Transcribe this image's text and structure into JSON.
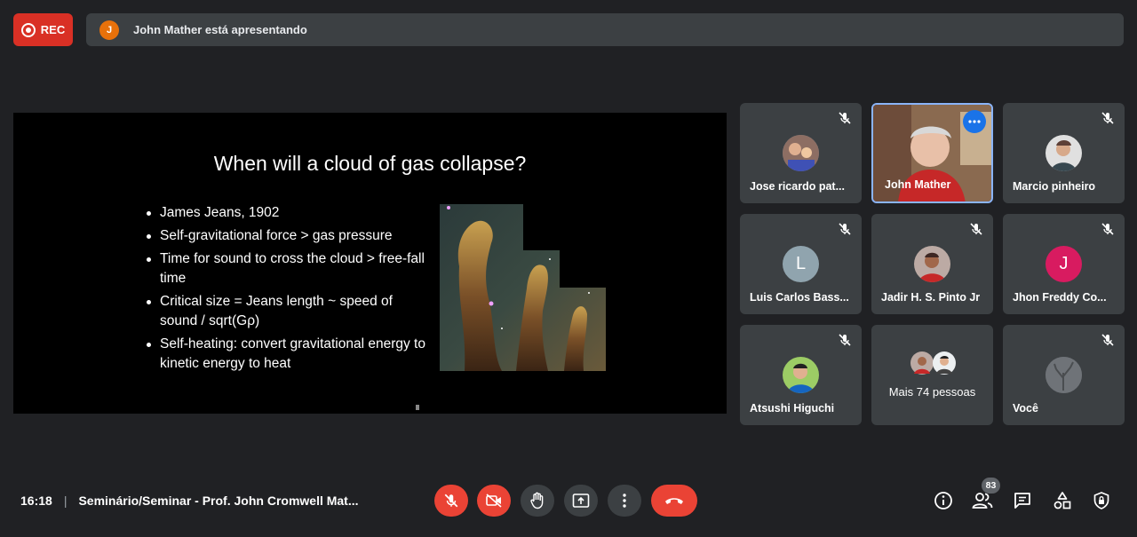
{
  "top": {
    "rec_label": "REC",
    "presenter_initial": "J",
    "presenting_text": "John Mather está apresentando"
  },
  "slide": {
    "title": "When will a cloud of gas collapse?",
    "bullets": [
      "James Jeans, 1902",
      "Self-gravitational force > gas pressure",
      "Time for sound to cross the cloud > free-fall time",
      "Critical size = Jeans length ~ speed of sound / sqrt(Gρ)",
      "Self-heating: convert gravitational energy to kinetic energy to heat"
    ]
  },
  "participants": [
    {
      "name": "Jose ricardo pat...",
      "muted": true
    },
    {
      "name": "John Mather",
      "muted": false,
      "speaking": true
    },
    {
      "name": "Marcio pinheiro",
      "muted": true
    },
    {
      "name": "Luis Carlos Bass...",
      "initial": "L",
      "color": "#90a4ae",
      "muted": true
    },
    {
      "name": "Jadir H. S. Pinto Jr",
      "muted": true
    },
    {
      "name": "Jhon Freddy Co...",
      "initial": "J",
      "color": "#d81b60",
      "muted": true
    },
    {
      "name": "Atsushi Higuchi",
      "muted": true
    },
    {
      "more_label": "Mais 74 pessoas"
    },
    {
      "name": "Você",
      "muted": true
    }
  ],
  "bottom": {
    "time": "16:18",
    "meeting_title": "Seminário/Seminar - Prof. John Cromwell Mat...",
    "participant_count": "83"
  },
  "colors": {
    "background": "#202124",
    "tile": "#3c4043",
    "red": "#ea4335",
    "accent": "#1a73e8"
  },
  "icons": [
    "info-icon",
    "people-icon",
    "chat-icon",
    "activities-icon",
    "host-controls-icon"
  ]
}
